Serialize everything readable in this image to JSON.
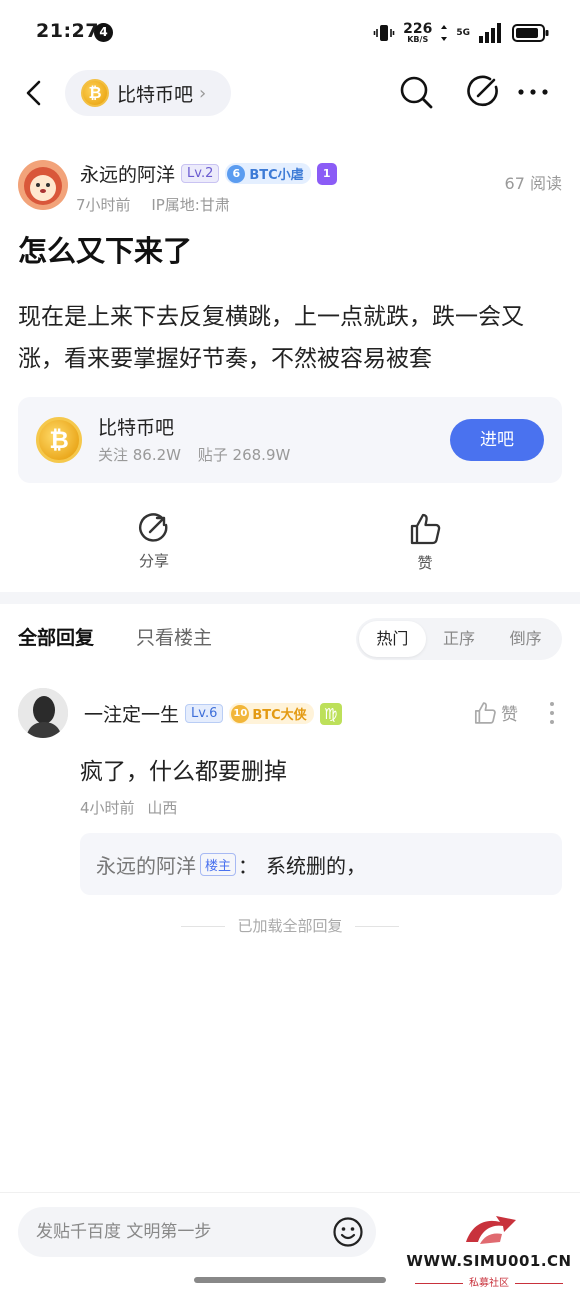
{
  "status_bar": {
    "time": "21:27",
    "notif_count": "4",
    "net_speed": "226",
    "net_unit": "KB/S",
    "net_type": "5G"
  },
  "nav": {
    "forum_name": "比特币吧",
    "coin_symbol": "₿",
    "chevron": "›"
  },
  "post": {
    "author": "永远的阿洋",
    "level": "Lv.2",
    "forum_badge_num": "6",
    "forum_badge_title": "BTC小虐",
    "medal_num": "1",
    "time_ago": "7小时前",
    "ip_location": "IP属地:甘肃",
    "read_count": "67 阅读",
    "title": "怎么又下来了",
    "body": "现在是上来下去反复横跳，上一点就跌，跌一会又涨，看来要掌握好节奏，不然被容易被套"
  },
  "forum_card": {
    "name": "比特币吧",
    "coin_symbol": "₿",
    "followers": "关注 86.2W",
    "posts": "贴子 268.9W",
    "join_label": "进吧"
  },
  "actions": {
    "share_label": "分享",
    "like_label": "赞"
  },
  "reply_tabs": {
    "all": "全部回复",
    "op_only": "只看楼主",
    "sort_hot": "热门",
    "sort_asc": "正序",
    "sort_desc": "倒序"
  },
  "comment": {
    "author": "一注定一生",
    "level": "Lv.6",
    "forum_badge_num": "10",
    "forum_badge_title": "BTC大侠",
    "zodiac": "♍",
    "like_label": "赞",
    "text": "疯了，什么都要删掉",
    "time_ago": "4小时前",
    "location": "山西",
    "reply": {
      "author": "永远的阿洋",
      "op_tag": "楼主",
      "colon": "：",
      "text": "系统删的，"
    }
  },
  "loaded_text": "已加载全部回复",
  "compose": {
    "placeholder": "发贴千百度 文明第一步"
  },
  "watermark": {
    "url": "WWW.SIMU001.CN",
    "subtitle": "私募社区"
  },
  "colors": {
    "accent_blue": "#4a72ef",
    "coin_gold": "#e59b00",
    "watermark_red": "#c8323c"
  }
}
